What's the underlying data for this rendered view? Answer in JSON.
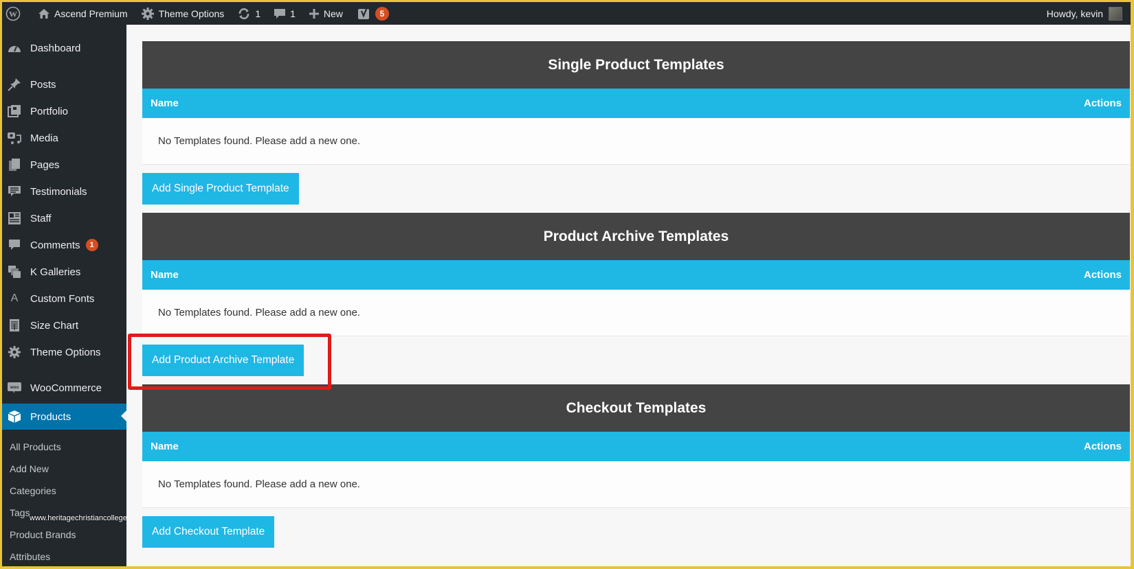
{
  "adminbar": {
    "site_name": "Ascend Premium",
    "theme_options": "Theme Options",
    "updates_count": "1",
    "comments_count": "1",
    "new_label": "New",
    "yoast_count": "5",
    "greeting": "Howdy, kevin"
  },
  "sidebar": {
    "items": [
      {
        "label": "Dashboard",
        "icon": "dashboard-icon"
      },
      {
        "label": "Posts",
        "icon": "pin-icon"
      },
      {
        "label": "Portfolio",
        "icon": "portfolio-icon"
      },
      {
        "label": "Media",
        "icon": "media-icon"
      },
      {
        "label": "Pages",
        "icon": "pages-icon"
      },
      {
        "label": "Testimonials",
        "icon": "testimonial-icon"
      },
      {
        "label": "Staff",
        "icon": "staff-icon"
      },
      {
        "label": "Comments",
        "icon": "comment-icon",
        "badge": "1"
      },
      {
        "label": "K Galleries",
        "icon": "gallery-icon"
      },
      {
        "label": "Custom Fonts",
        "icon": "font-icon"
      },
      {
        "label": "Size Chart",
        "icon": "document-icon"
      },
      {
        "label": "Theme Options",
        "icon": "gear-icon"
      },
      {
        "label": "WooCommerce",
        "icon": "woocommerce-icon"
      },
      {
        "label": "Products",
        "icon": "box-icon",
        "active": true
      }
    ],
    "submenu": [
      "All Products",
      "Add New",
      "Categories",
      "Tags",
      "Product Brands",
      "Attributes"
    ],
    "watermark": "www.heritagechristiancollege.c"
  },
  "main": {
    "sections": [
      {
        "title": "Single Product Templates",
        "col_name": "Name",
        "col_actions": "Actions",
        "empty_text": "No Templates found. Please add a new one.",
        "button": "Add Single Product Template"
      },
      {
        "title": "Product Archive Templates",
        "col_name": "Name",
        "col_actions": "Actions",
        "empty_text": "No Templates found. Please add a new one.",
        "button": "Add Product Archive Template",
        "highlighted": true
      },
      {
        "title": "Checkout Templates",
        "col_name": "Name",
        "col_actions": "Actions",
        "empty_text": "No Templates found. Please add a new one.",
        "button": "Add Checkout Template"
      }
    ]
  },
  "colors": {
    "accent": "#1fb7e4",
    "header_dark": "#444444",
    "highlight": "#e01b1b",
    "admin_bar": "#23282d",
    "active_menu": "#0073aa"
  }
}
